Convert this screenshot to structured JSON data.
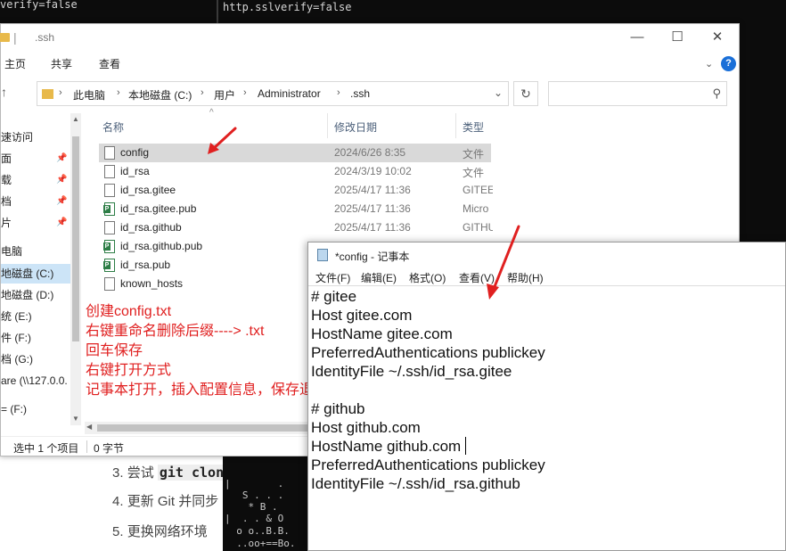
{
  "top_terminal": {
    "left_text": "verify=false",
    "right_text": "http.sslverify=false"
  },
  "explorer": {
    "title": ".ssh",
    "title_sep": "|",
    "window_buttons": {
      "minimize": "—",
      "maximize": "☐",
      "close": "✕"
    },
    "ribbon": {
      "home": "主页",
      "share": "共享",
      "view": "查看",
      "collapse": "⌄",
      "help": "?"
    },
    "breadcrumbs": [
      "此电脑",
      "本地磁盘 (C:)",
      "用户",
      "Administrator",
      ".ssh"
    ],
    "breadcrumb_sep": "›",
    "nav_items": [
      {
        "label": "速访问",
        "pinned": false
      },
      {
        "label": "面",
        "pinned": true
      },
      {
        "label": "载",
        "pinned": true
      },
      {
        "label": "档",
        "pinned": true
      },
      {
        "label": "片",
        "pinned": true
      },
      {
        "label": "",
        "pinned": false
      },
      {
        "label": "电脑",
        "pinned": false
      },
      {
        "label": "地磁盘 (C:)",
        "pinned": false,
        "selected": true
      },
      {
        "label": "地磁盘 (D:)",
        "pinned": false
      },
      {
        "label": "统 (E:)",
        "pinned": false
      },
      {
        "label": "件 (F:)",
        "pinned": false
      },
      {
        "label": "档 (G:)",
        "pinned": false
      },
      {
        "label": "are (\\\\127.0.0.",
        "pinned": false
      },
      {
        "label": "",
        "pinned": false
      },
      {
        "label": "= (F:)",
        "pinned": false
      }
    ],
    "columns": {
      "name": "名称",
      "modified": "修改日期",
      "type": "类型"
    },
    "files": [
      {
        "name": "config",
        "date": "2024/6/26 8:35",
        "type": "文件",
        "icon": "file-icon",
        "selected": true
      },
      {
        "name": "id_rsa",
        "date": "2024/3/19 10:02",
        "type": "文件",
        "icon": "file-icon"
      },
      {
        "name": "id_rsa.gitee",
        "date": "2025/4/17 11:36",
        "type": "GITEE",
        "icon": "file-icon"
      },
      {
        "name": "id_rsa.gitee.pub",
        "date": "2025/4/17 11:36",
        "type": "Micro",
        "icon": "publisher-icon"
      },
      {
        "name": "id_rsa.github",
        "date": "2025/4/17 11:36",
        "type": "GITHU",
        "icon": "file-icon"
      },
      {
        "name": "id_rsa.github.pub",
        "date": "",
        "type": "",
        "icon": "publisher-icon"
      },
      {
        "name": "id_rsa.pub",
        "date": "",
        "type": "",
        "icon": "publisher-icon"
      },
      {
        "name": "known_hosts",
        "date": "",
        "type": "",
        "icon": "file-icon"
      }
    ],
    "status": {
      "selected": "选中 1 个项目",
      "size": "0 字节"
    },
    "annotations": [
      "创建config.txt",
      "右键重命名删除后缀----> .txt",
      "回车保存",
      "右键打开方式",
      "记事本打开，插入配置信息，保存退出"
    ]
  },
  "notepad": {
    "title": "*config - 记事本",
    "menu": [
      "文件(F)",
      "编辑(E)",
      "格式(O)",
      "查看(V)",
      "帮助(H)"
    ],
    "lines": [
      "# gitee",
      "Host gitee.com",
      "HostName gitee.com",
      "PreferredAuthentications publickey",
      "IdentityFile ~/.ssh/id_rsa.gitee",
      "# github",
      "Host github.com",
      "HostName github.com",
      "PreferredAuthentications publickey",
      "IdentityFile ~/.ssh/id_rsa.github"
    ]
  },
  "background_doc": {
    "items": [
      {
        "number": "3.",
        "text": "尝试",
        "code": "git clon"
      },
      {
        "number": "4.",
        "text": "更新 Git 并同步"
      },
      {
        "number": "5.",
        "text": "更换网络环境"
      }
    ]
  },
  "terminal_fragment": {
    "lines": [
      "|        .",
      "   S . . .",
      "    * B .",
      "|  . . & O",
      "  o o..B.B.",
      "  ..oo+==Bo."
    ]
  },
  "colors": {
    "annotation_red": "#e02020",
    "selection": "#d9d9d9",
    "nav_selection": "#cce4f7",
    "help_blue": "#1a6fd8"
  }
}
